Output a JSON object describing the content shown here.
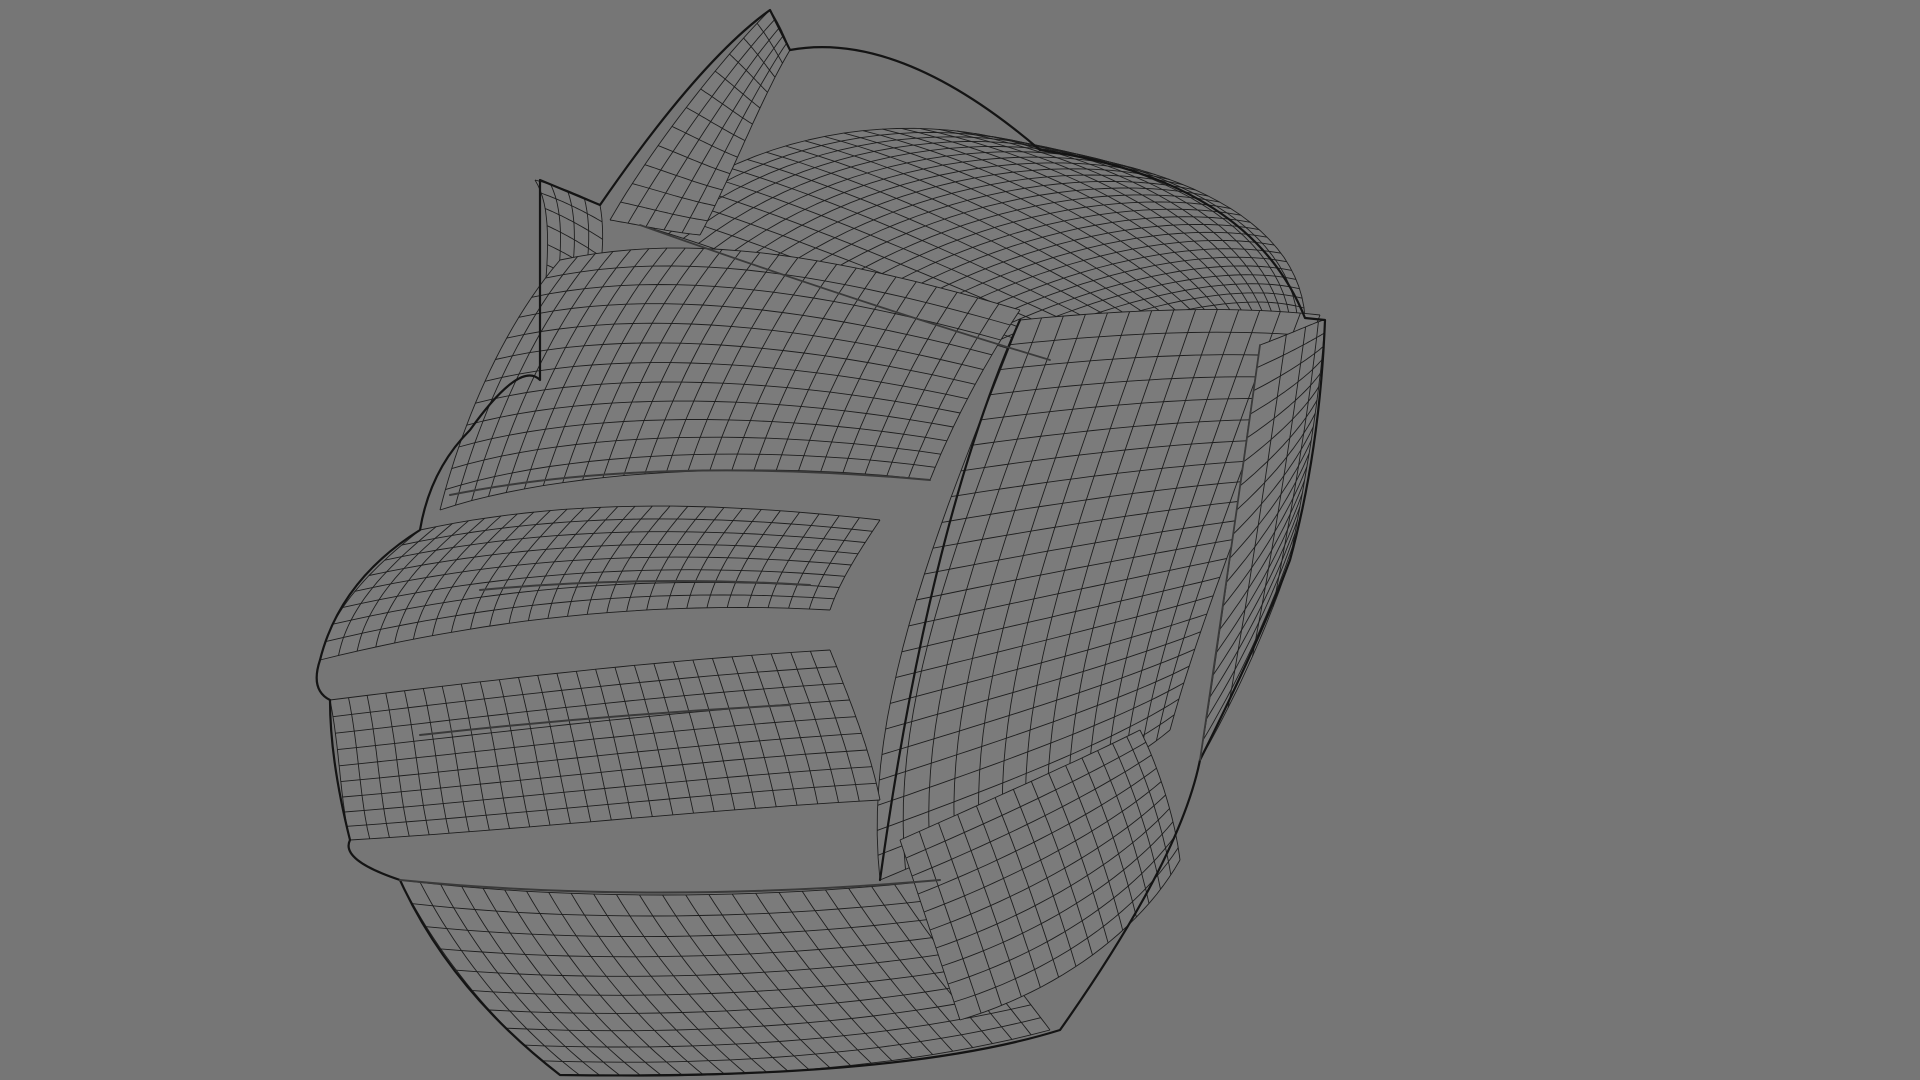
{
  "viewport": {
    "background_color": "#767676",
    "model_subject": "helmet",
    "display_mode": "wireframe-on-shaded",
    "shade_color": "#7b7b7b",
    "wire_color": "#1e1e1e",
    "seam_color": "#3a3a3a"
  }
}
